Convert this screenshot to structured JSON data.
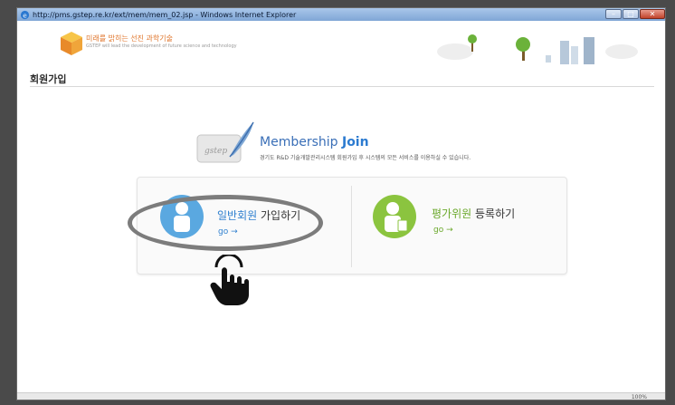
{
  "window": {
    "title": "http://pms.gstep.re.kr/ext/mem/mem_02.jsp - Windows Internet Explorer"
  },
  "header": {
    "logo_text": "미래를 밝히는 선진 과학기술",
    "logo_sub": "GSTEP will lead the development of future science and technology"
  },
  "page": {
    "title": "회원가입"
  },
  "membership": {
    "title_part1": "Membership",
    "title_part2": "Join",
    "description": "경기도 R&D 기술개발관리시스템 회원가입 후 시스템의 모든 서비스를 이용하실 수 있습니다.",
    "icon_text": "gstep"
  },
  "options": [
    {
      "label_highlight": "일반회원",
      "label_rest": "가입하기",
      "go": "go →"
    },
    {
      "label_highlight": "평가위원",
      "label_rest": "등록하기",
      "go": "go →"
    }
  ],
  "statusbar": {
    "zoom": "100%"
  },
  "colors": {
    "blue": "#2e7fcf",
    "green": "#6aa82a",
    "general_circle": "#5aa8e0",
    "eval_circle": "#8bc43f",
    "annotation": "#7c7c7c"
  }
}
